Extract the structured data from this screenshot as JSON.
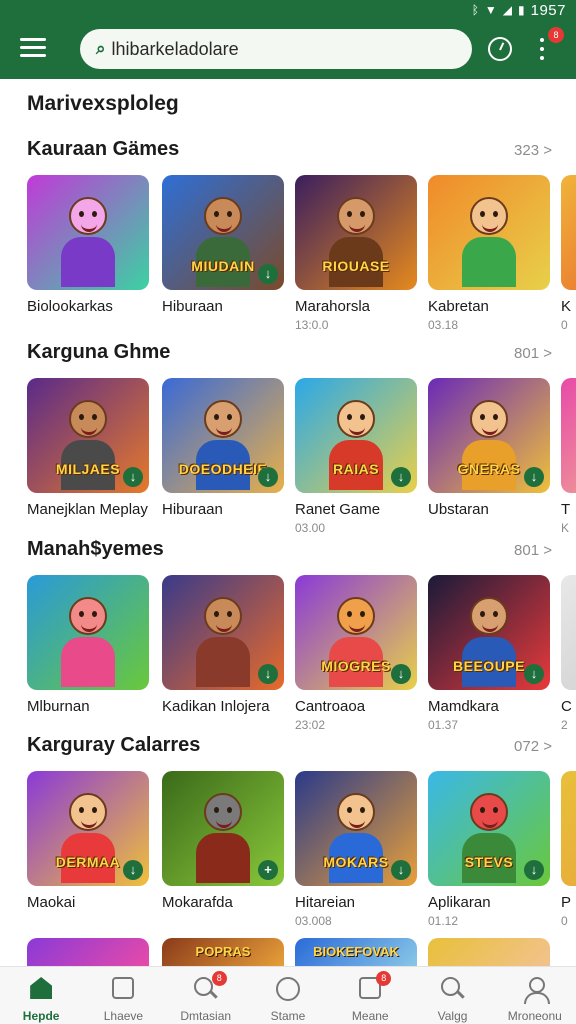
{
  "status_bar": {
    "time": "1957"
  },
  "search": {
    "value": "lhibarkeladolare"
  },
  "notification_count": "8",
  "page_title": "Marivexsploleg",
  "sections": [
    {
      "title": "Kauraan Gämes",
      "more": "323 >",
      "cards": [
        {
          "title": "Biolookarkas",
          "meta": "",
          "logo": "",
          "c1": "#c03ad8",
          "c2": "#3bd2a2",
          "skin": "#f3a6e8",
          "shirt": "#7a3ac8",
          "icon": ""
        },
        {
          "title": "Hiburaan",
          "meta": "",
          "logo": "MIUDAIN",
          "c1": "#2e6fd6",
          "c2": "#7a4a2a",
          "skin": "#c98a5a",
          "shirt": "#3a6a3a",
          "icon": "↓"
        },
        {
          "title": "Marahorsla",
          "meta": "13:0.0",
          "logo": "RIOUASE",
          "c1": "#3a1e5e",
          "c2": "#e68a1e",
          "skin": "#d69a6a",
          "shirt": "#6a3a1a",
          "icon": ""
        },
        {
          "title": "Kabretan",
          "meta": "03.18",
          "logo": "",
          "c1": "#f08a2a",
          "c2": "#e8d04a",
          "skin": "#f2c28f",
          "shirt": "#3aa84a",
          "icon": ""
        },
        {
          "title": "K",
          "meta": "0",
          "logo": "",
          "c1": "#f0b43a",
          "c2": "#e85a2a",
          "skin": "#f2c28f",
          "shirt": "#e85a2a",
          "icon": ""
        }
      ]
    },
    {
      "title": "Karguna Ghme",
      "more": "801 >",
      "cards": [
        {
          "title": "Manejklan Meplay",
          "meta": "",
          "logo": "MILJAES",
          "c1": "#5a2a8a",
          "c2": "#e67a2a",
          "skin": "#c98a5a",
          "shirt": "#4a4a4a",
          "icon": "↓"
        },
        {
          "title": "Hiburaan",
          "meta": "",
          "logo": "DOEODHEIE",
          "c1": "#3a6ad6",
          "c2": "#e8b04a",
          "skin": "#d8a070",
          "shirt": "#2a5ab8",
          "icon": "↓"
        },
        {
          "title": "Ranet Game",
          "meta": "03.00",
          "logo": "RAIAS",
          "c1": "#2aa8e8",
          "c2": "#e8d04a",
          "skin": "#f2c28f",
          "shirt": "#d83a2a",
          "icon": "↓"
        },
        {
          "title": "Ubstaran",
          "meta": "",
          "logo": "GNERAS",
          "c1": "#6a2ab8",
          "c2": "#f0c03a",
          "skin": "#f2c28f",
          "shirt": "#e8a02a",
          "icon": "↓"
        },
        {
          "title": "T",
          "meta": "K",
          "logo": "",
          "c1": "#e84aa8",
          "c2": "#f2c28f",
          "skin": "#f2c28f",
          "shirt": "#e84aa8",
          "icon": ""
        }
      ]
    },
    {
      "title": "Manah$yemes",
      "more": "801 >",
      "cards": [
        {
          "title": "Mlburnan",
          "meta": "",
          "logo": "",
          "c1": "#2a9ad8",
          "c2": "#6ac83a",
          "skin": "#f28a8a",
          "shirt": "#e84a8a",
          "icon": ""
        },
        {
          "title": "Kadikan Inlojera",
          "meta": "",
          "logo": "",
          "c1": "#3a3a8a",
          "c2": "#e86a2a",
          "skin": "#c98a5a",
          "shirt": "#8a3a2a",
          "icon": "↓"
        },
        {
          "title": "Cantroaoa",
          "meta": "23:02",
          "logo": "MIOGRES",
          "c1": "#8a3ad8",
          "c2": "#e8d04a",
          "skin": "#f0a04a",
          "shirt": "#e84a4a",
          "icon": "↓"
        },
        {
          "title": "Mamdkara",
          "meta": "01.37",
          "logo": "BEEOUPE",
          "c1": "#1a1a3a",
          "c2": "#e83a3a",
          "skin": "#d8a070",
          "shirt": "#2a5ab8",
          "icon": "↓"
        },
        {
          "title": "C",
          "meta": "2",
          "logo": "",
          "c1": "#e8e8e8",
          "c2": "#c8c8c8",
          "skin": "#f2c28f",
          "shirt": "#c8c8c8",
          "icon": ""
        }
      ]
    },
    {
      "title": "Karguray Calarres",
      "more": "072 >",
      "cards": [
        {
          "title": "Maokai",
          "meta": "",
          "logo": "DERMAA",
          "c1": "#8a3ad8",
          "c2": "#f0c03a",
          "skin": "#f2c28f",
          "shirt": "#e83a3a",
          "icon": "↓"
        },
        {
          "title": "Mokarafda",
          "meta": "",
          "logo": "",
          "c1": "#3a6a1a",
          "c2": "#8ac83a",
          "skin": "#7a7a7a",
          "shirt": "#8a2a1a",
          "icon": "+"
        },
        {
          "title": "Hitareian",
          "meta": "03.008",
          "logo": "MOKARS",
          "c1": "#2a3a8a",
          "c2": "#e8a03a",
          "skin": "#f2c28f",
          "shirt": "#2a6ad8",
          "icon": "↓"
        },
        {
          "title": "Aplikaran",
          "meta": "01.12",
          "logo": "STEVS",
          "c1": "#3ab8e8",
          "c2": "#6ac83a",
          "skin": "#e84a4a",
          "shirt": "#3a8a3a",
          "icon": "↓"
        },
        {
          "title": "P",
          "meta": "0",
          "logo": "",
          "c1": "#e8c03a",
          "c2": "#e8a03a",
          "skin": "#f2c28f",
          "shirt": "#e8a03a",
          "icon": ""
        }
      ]
    }
  ],
  "peek_row": [
    {
      "text": "",
      "c1": "#8a3ad8",
      "c2": "#e84aa8"
    },
    {
      "text": "POPRAS",
      "c1": "#8a3a1a",
      "c2": "#e8a03a"
    },
    {
      "text": "BIOKEFOVAK",
      "c1": "#2a6ad8",
      "c2": "#8ac8e8"
    },
    {
      "text": "",
      "c1": "#e8c03a",
      "c2": "#f2c28f"
    }
  ],
  "bottom_nav": [
    {
      "label": "Hepde",
      "icon": "home-icon",
      "active": true,
      "badge": ""
    },
    {
      "label": "Lhaeve",
      "icon": "library-icon",
      "active": false,
      "badge": ""
    },
    {
      "label": "Dmtasian",
      "icon": "search-badge-icon",
      "active": false,
      "badge": "8"
    },
    {
      "label": "Stame",
      "icon": "circle-icon",
      "active": false,
      "badge": ""
    },
    {
      "label": "Meane",
      "icon": "inbox-icon",
      "active": false,
      "badge": "8"
    },
    {
      "label": "Valgg",
      "icon": "search-icon",
      "active": false,
      "badge": ""
    },
    {
      "label": "Mroneonu",
      "icon": "profile-icon",
      "active": false,
      "badge": ""
    }
  ]
}
